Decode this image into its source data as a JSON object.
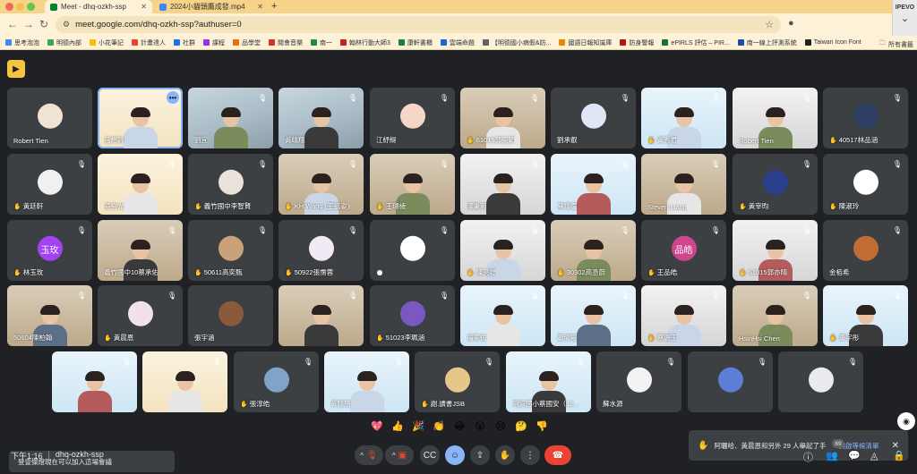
{
  "browser": {
    "tabs": [
      {
        "title": "Meet - dhq-ozkh-ssp",
        "favicon_color": "#00832d"
      },
      {
        "title": "2024小貓頭鷹成發.mp4",
        "favicon_color": "#4285f4"
      }
    ],
    "new_tab": "+",
    "url": "meet.google.com/dhq-ozkh-ssp?authuser=0",
    "extension_label": "IPEVO",
    "bookmarks": [
      {
        "label": "思考泡泡",
        "color": "#4285f4"
      },
      {
        "label": "明德內部",
        "color": "#34a853"
      },
      {
        "label": "小花筆記",
        "color": "#fbbc04"
      },
      {
        "label": "計畫達人",
        "color": "#ea4335"
      },
      {
        "label": "社群",
        "color": "#1a73e8"
      },
      {
        "label": "課程",
        "color": "#9334e6"
      },
      {
        "label": "品學堂",
        "color": "#e8710a"
      },
      {
        "label": "閱會音樂",
        "color": "#d93025"
      },
      {
        "label": "南一",
        "color": "#1e8e3e"
      },
      {
        "label": "翰林行動大師3",
        "color": "#c5221f"
      },
      {
        "label": "康軒書櫃",
        "color": "#188038"
      },
      {
        "label": "雲端命題",
        "color": "#1967d2"
      },
      {
        "label": "【明德國小病假&防...",
        "color": "#5f6368"
      },
      {
        "label": "國語日報知識庫",
        "color": "#ea8600"
      },
      {
        "label": "防身警報",
        "color": "#b31412"
      },
      {
        "label": "ePIRLS 評估 – PIR...",
        "color": "#137333"
      },
      {
        "label": "南一線上評測系統",
        "color": "#174ea6"
      },
      {
        "label": "Taiwan Icon Font",
        "color": "#202124"
      }
    ],
    "bookmarks_folder": "所有書籤"
  },
  "tiles": [
    {
      "name": "Robert Tien",
      "kind": "avatar",
      "avatar_color": "#f1e3d3",
      "mic_off": false
    },
    {
      "name": "花想錦",
      "kind": "banner-cream",
      "speaking": true,
      "more": true,
      "mic_off": false
    },
    {
      "name": "劉宜",
      "kind": "video",
      "mic_off": true
    },
    {
      "name": "黃靖翔",
      "kind": "video",
      "mic_off": true
    },
    {
      "name": "江紓緹",
      "kind": "avatar",
      "avatar_color": "#f6d6c7",
      "mic_off": true
    },
    {
      "name": "61015郭奕穎",
      "kind": "room",
      "hand": true,
      "mic_off": true
    },
    {
      "name": "劉承叡",
      "kind": "avatar",
      "avatar_color": "#dfe6f7",
      "mic_off": true
    },
    {
      "name": "黃秀君",
      "kind": "banner",
      "hand": true,
      "mic_off": true
    },
    {
      "name": "Robert Tien",
      "kind": "bright",
      "mic_off": true
    },
    {
      "name": "40517林品涵",
      "kind": "avatar",
      "avatar_color": "#2f3f63",
      "hand": true,
      "mic_off": true
    },
    {
      "name": "黃廷軒",
      "kind": "avatar",
      "avatar_color": "#f0f0f0",
      "hand": true,
      "mic_off": true
    },
    {
      "name": "吳裕光",
      "kind": "banner-cream",
      "mic_off": true
    },
    {
      "name": "義竹國中李智賢",
      "kind": "avatar",
      "avatar_color": "#e9e2d8",
      "hand": true,
      "mic_off": true
    },
    {
      "name": "KH Wang (王凱姿)",
      "kind": "room",
      "hand": true,
      "mic_off": true
    },
    {
      "name": "王璿綾",
      "kind": "room",
      "hand": true,
      "mic_off": true
    },
    {
      "name": "陳秉利",
      "kind": "bright",
      "mic_off": true
    },
    {
      "name": "蘇靖媛",
      "kind": "banner",
      "mic_off": true
    },
    {
      "name": "Steven Liang",
      "kind": "room",
      "mic_off": true
    },
    {
      "name": "黃宰昀",
      "kind": "avatar",
      "avatar_color": "#2b3f8a",
      "hand": true,
      "mic_off": true
    },
    {
      "name": "陳淑玲",
      "kind": "avatar",
      "avatar_color": "#ffffff",
      "hand": true,
      "mic_off": true
    },
    {
      "name": "林玉玫",
      "kind": "avatar",
      "letter": "玉玫",
      "avatar_color": "#a142f4",
      "hand": true,
      "mic_off": true
    },
    {
      "name": "義竹國中10蔡承佑",
      "kind": "room",
      "mic_off": true
    },
    {
      "name": "50611高奕甄",
      "kind": "avatar",
      "avatar_color": "#c9a27c",
      "hand": true,
      "mic_off": true
    },
    {
      "name": "50922張霈蓉",
      "kind": "avatar",
      "avatar_color": "#f1e9f3",
      "hand": true,
      "mic_off": true
    },
    {
      "name": "",
      "kind": "avatar",
      "avatar_color": "#ffffff",
      "dot": true,
      "mic_off": true
    },
    {
      "name": "陳亮妤",
      "kind": "bright",
      "hand": true,
      "mic_off": true
    },
    {
      "name": "30302高丞蔚",
      "kind": "room",
      "hand": true,
      "mic_off": true
    },
    {
      "name": "王品皓",
      "kind": "avatar",
      "letter": "品皓",
      "avatar_color": "#d0458e",
      "hand": true,
      "mic_off": true
    },
    {
      "name": "51015郭亦晴",
      "kind": "bright",
      "hand": true,
      "mic_off": true
    },
    {
      "name": "金栢希",
      "kind": "avatar",
      "avatar_color": "#c36b34",
      "mic_off": true
    },
    {
      "name": "50604陳柏翰",
      "kind": "room",
      "mic_off": true
    },
    {
      "name": "黃晨恩",
      "kind": "avatar",
      "avatar_color": "#f3e1ea",
      "hand": true,
      "mic_off": true
    },
    {
      "name": "張宇涵",
      "kind": "avatar",
      "avatar_color": "#8a5a3a",
      "mic_off": false
    },
    {
      "name": "",
      "kind": "room",
      "mic_off": true
    },
    {
      "name": "51023李珮涵",
      "kind": "avatar",
      "avatar_color": "#7b57c2",
      "hand": true,
      "mic_off": true
    },
    {
      "name": "楊家悅",
      "kind": "banner",
      "mic_off": true
    },
    {
      "name": "蕭清殿",
      "kind": "banner",
      "mic_off": true
    },
    {
      "name": "蔡惠玉",
      "kind": "bright",
      "hand": true,
      "mic_off": true
    },
    {
      "name": "HsinHsi Chen",
      "kind": "room",
      "mic_off": true
    },
    {
      "name": "蕭宇彤",
      "kind": "banner",
      "hand": true,
      "mic_off": true
    },
    {
      "name": "",
      "kind": "banner",
      "mic_off": true
    },
    {
      "name": "",
      "kind": "banner-cream",
      "mic_off": true
    },
    {
      "name": "張淳皓",
      "kind": "avatar",
      "avatar_color": "#7fa3c9",
      "hand": true,
      "mic_off": true
    },
    {
      "name": "黃晴朋",
      "kind": "banner",
      "mic_off": true
    },
    {
      "name": "謝.讀書JSB",
      "kind": "avatar",
      "avatar_color": "#e6c78a",
      "hand": true,
      "mic_off": true
    },
    {
      "name": "明道國小蔡國安（12...",
      "kind": "banner",
      "mic_off": true
    },
    {
      "name": "蘇水源",
      "kind": "avatar",
      "avatar_color": "#f3f3f3",
      "mic_off": true
    },
    {
      "name": "",
      "kind": "avatar",
      "avatar_color": "#5b7fd6",
      "mic_off": true
    },
    {
      "name": "",
      "kind": "avatar",
      "avatar_color": "#e8eaed",
      "mic_off": true
    }
  ],
  "toast_left": "登壹傑燈現在可以加入這場會議",
  "toast_right": {
    "text": "阿曬哈、黃晨恩和另外 29 人舉起了手",
    "action": "開啟等候清單"
  },
  "reactions": [
    "💖",
    "👍",
    "🎉",
    "👏",
    "😂",
    "😮",
    "😢",
    "🤔",
    "👎"
  ],
  "meeting": {
    "time": "下午1:16",
    "separator": "|",
    "code": "dhq-ozkh-ssp"
  },
  "participants_count": "69",
  "colors": {
    "bg": "#202124",
    "tile": "#3c4043",
    "accent": "#8ab4f8",
    "end": "#ea4335",
    "chrome": "#f6d388"
  }
}
